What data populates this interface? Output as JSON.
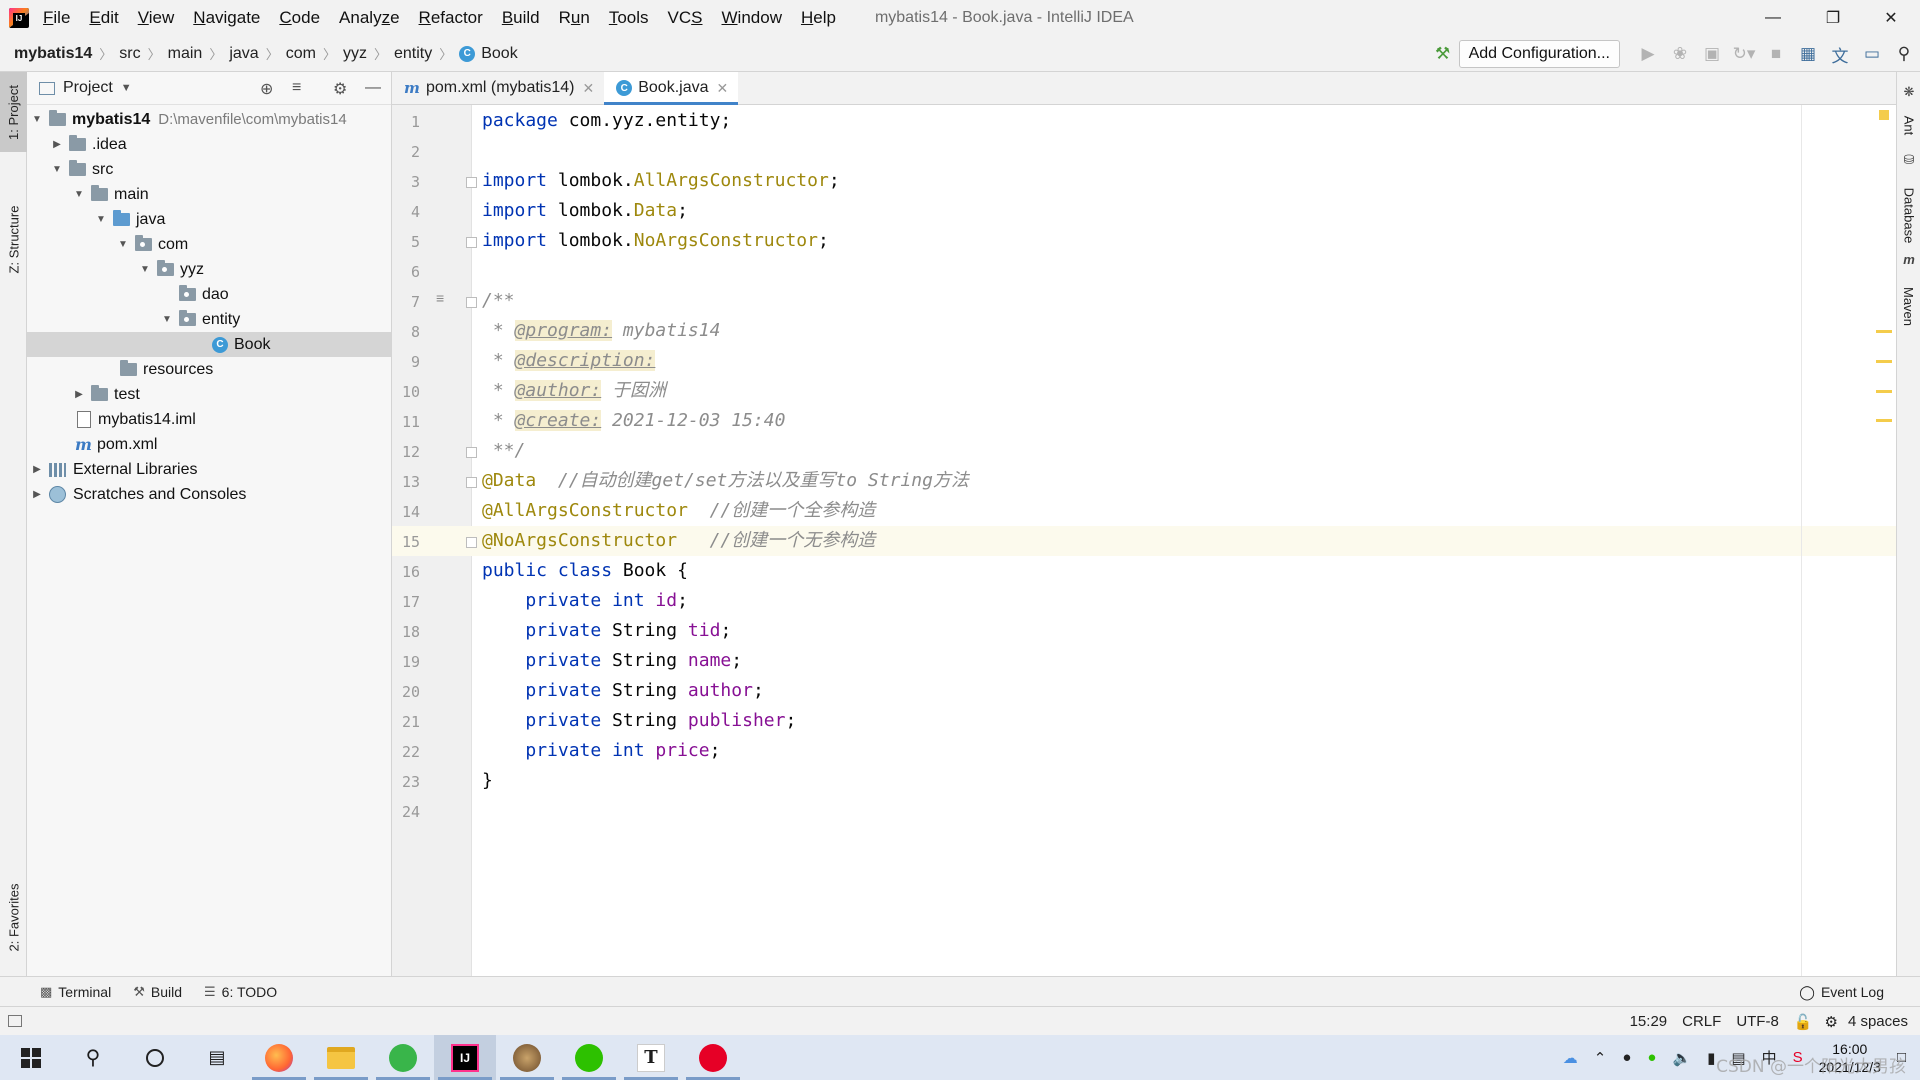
{
  "menu": {
    "items": [
      "File",
      "Edit",
      "View",
      "Navigate",
      "Code",
      "Analyze",
      "Refactor",
      "Build",
      "Run",
      "Tools",
      "VCS",
      "Window",
      "Help"
    ],
    "mnemonics": [
      "F",
      "E",
      "V",
      "N",
      "C",
      "z",
      "R",
      "B",
      "u",
      "T",
      "S",
      "W",
      "H"
    ],
    "window_title": "mybatis14 - Book.java - IntelliJ IDEA"
  },
  "breadcrumb": [
    "mybatis14",
    "src",
    "main",
    "java",
    "com",
    "yyz",
    "entity",
    "Book"
  ],
  "toolbar": {
    "add_configuration": "Add Configuration..."
  },
  "left_strip": {
    "project_tab": "1: Project",
    "structure_tab": "Z: Structure",
    "favorites_tab": "2: Favorites"
  },
  "right_strip": {
    "tabs": [
      "Ant",
      "Database",
      "Maven"
    ]
  },
  "project_panel": {
    "title": "Project",
    "tree": [
      {
        "label": "mybatis14",
        "hint": "D:\\mavenfile\\com\\mybatis14",
        "icon": "module-folder-icon",
        "expanded": true
      },
      {
        "label": ".idea",
        "icon": "folder-icon",
        "expanded": false
      },
      {
        "label": "src",
        "icon": "folder-icon",
        "expanded": true
      },
      {
        "label": "main",
        "icon": "folder-icon",
        "expanded": true
      },
      {
        "label": "java",
        "icon": "source-folder-icon",
        "expanded": true
      },
      {
        "label": "com",
        "icon": "package-icon",
        "expanded": true
      },
      {
        "label": "yyz",
        "icon": "package-icon",
        "expanded": true
      },
      {
        "label": "dao",
        "icon": "package-icon"
      },
      {
        "label": "entity",
        "icon": "package-icon",
        "expanded": true
      },
      {
        "label": "Book",
        "icon": "class-icon",
        "selected": true
      },
      {
        "label": "resources",
        "icon": "resources-folder-icon"
      },
      {
        "label": "test",
        "icon": "folder-icon",
        "expanded": false
      },
      {
        "label": "mybatis14.iml",
        "icon": "iml-file-icon"
      },
      {
        "label": "pom.xml",
        "icon": "maven-icon"
      },
      {
        "label": "External Libraries",
        "icon": "libraries-icon",
        "expanded": false
      },
      {
        "label": "Scratches and Consoles",
        "icon": "scratches-icon",
        "expanded": false
      }
    ]
  },
  "editor": {
    "tabs": [
      {
        "label": "pom.xml (mybatis14)",
        "icon": "maven-icon",
        "active": false
      },
      {
        "label": "Book.java",
        "icon": "class-icon",
        "active": true
      }
    ],
    "line_numbers": [
      "1",
      "2",
      "3",
      "4",
      "5",
      "6",
      "7",
      "8",
      "9",
      "10",
      "11",
      "12",
      "13",
      "14",
      "15",
      "16",
      "17",
      "18",
      "19",
      "20",
      "21",
      "22",
      "23",
      "24"
    ],
    "code": {
      "l1_kw": "package",
      "l1_rest": " com.yyz.entity;",
      "import_kw": "import",
      "l3_pkg": " lombok.",
      "l3_cls": "AllArgsConstructor",
      "l4_cls": "Data",
      "l5_cls": "NoArgsConstructor",
      "semicolon": ";",
      "l7": "/**",
      "doc_prefix": " * ",
      "tag_program": "@program:",
      "val_program": " mybatis14",
      "tag_description": "@description:",
      "tag_author": "@author:",
      "val_author": " 于囡洲",
      "tag_create": "@create:",
      "val_create": " 2021-12-03 15:40",
      "l12": " **/",
      "l13_ann": "@Data",
      "l13_cmt": "  //自动创建get/set方法以及重写to String方法",
      "l14_ann": "@AllArgsConstructor",
      "l14_cmt": "  //创建一个全参构造",
      "l15_ann": "@NoArgsConstructor",
      "l15_cmt": "   //创建一个无参构造",
      "l16_kw": "public class",
      "l16_rest": " Book {",
      "indent": "    ",
      "private_kw": "private",
      "int_kw": "int",
      "string_type": " String ",
      "f_id": "id",
      "f_tid": "tid",
      "f_name": "name",
      "f_author": "author",
      "f_publisher": "publisher",
      "f_price": "price",
      "l23": "}"
    }
  },
  "bottom_tools": {
    "terminal": "Terminal",
    "build": "Build",
    "todo": "6: TODO",
    "event_log": "Event Log"
  },
  "status": {
    "position": "15:29",
    "line_separator": "CRLF",
    "encoding": "UTF-8",
    "indent": "4 spaces"
  },
  "taskbar": {
    "time": "16:00",
    "date": "2021/12/3",
    "watermark": "CSDN @一个阳光大男孩",
    "apps": [
      "start-icon",
      "search-icon",
      "cortana-icon",
      "task-view-icon",
      "firefox-icon",
      "file-explorer-icon",
      "wechat-green-icon",
      "intellij-icon",
      "game-icon",
      "wechat-icon",
      "typora-icon",
      "netease-music-icon"
    ]
  },
  "colors": {
    "keyword": "#0033b3",
    "annotation": "#9e880d",
    "field": "#871094",
    "comment": "#8c8c8c",
    "accent": "#4083c9"
  }
}
